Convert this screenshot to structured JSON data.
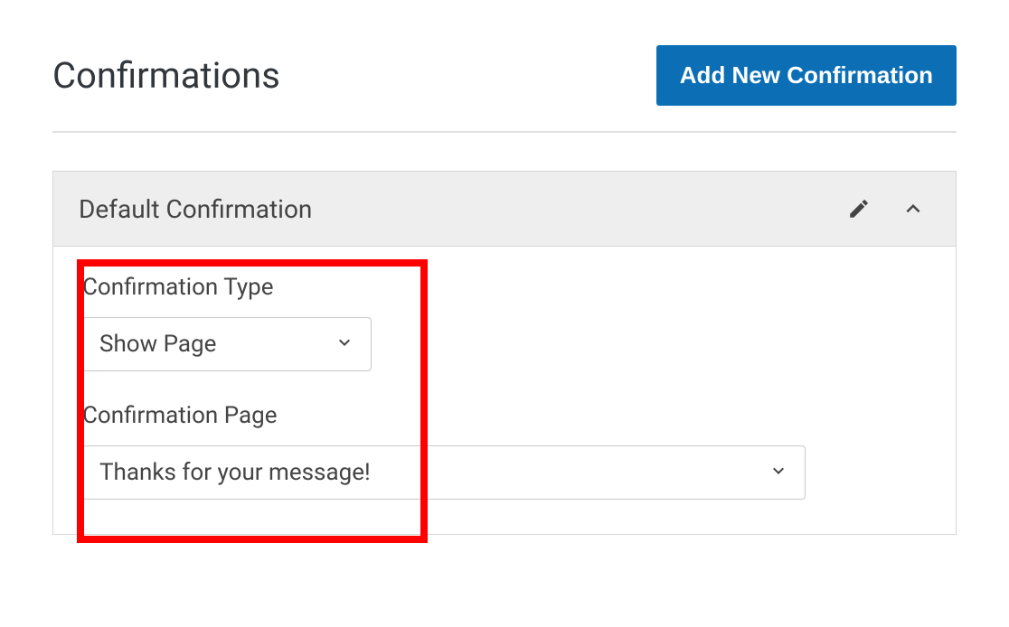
{
  "header": {
    "title": "Confirmations",
    "add_button": "Add New Confirmation"
  },
  "panel": {
    "title": "Default Confirmation",
    "fields": {
      "type_label": "Confirmation Type",
      "type_value": "Show Page",
      "page_label": "Confirmation Page",
      "page_value": "Thanks for your message!"
    }
  }
}
